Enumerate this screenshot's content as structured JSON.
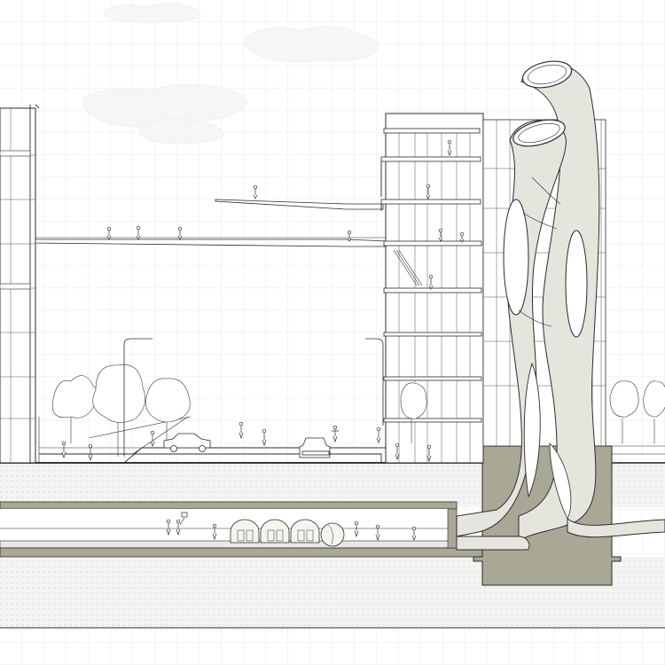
{
  "drawing": {
    "kind": "architectural-section",
    "colors": {
      "background": "#ffffff",
      "grid": "#dcdcdc",
      "ink": "#2b2b2b",
      "earth_fill": "#f4f4f2",
      "earth_hatch": "#cfcfcf",
      "concrete": "#a9a896",
      "concrete_dark": "#8f8e7c",
      "tube_fill": "#e6e5dd",
      "tube_inner": "#f3f2ec",
      "cloud": "#f7f7f7"
    }
  }
}
